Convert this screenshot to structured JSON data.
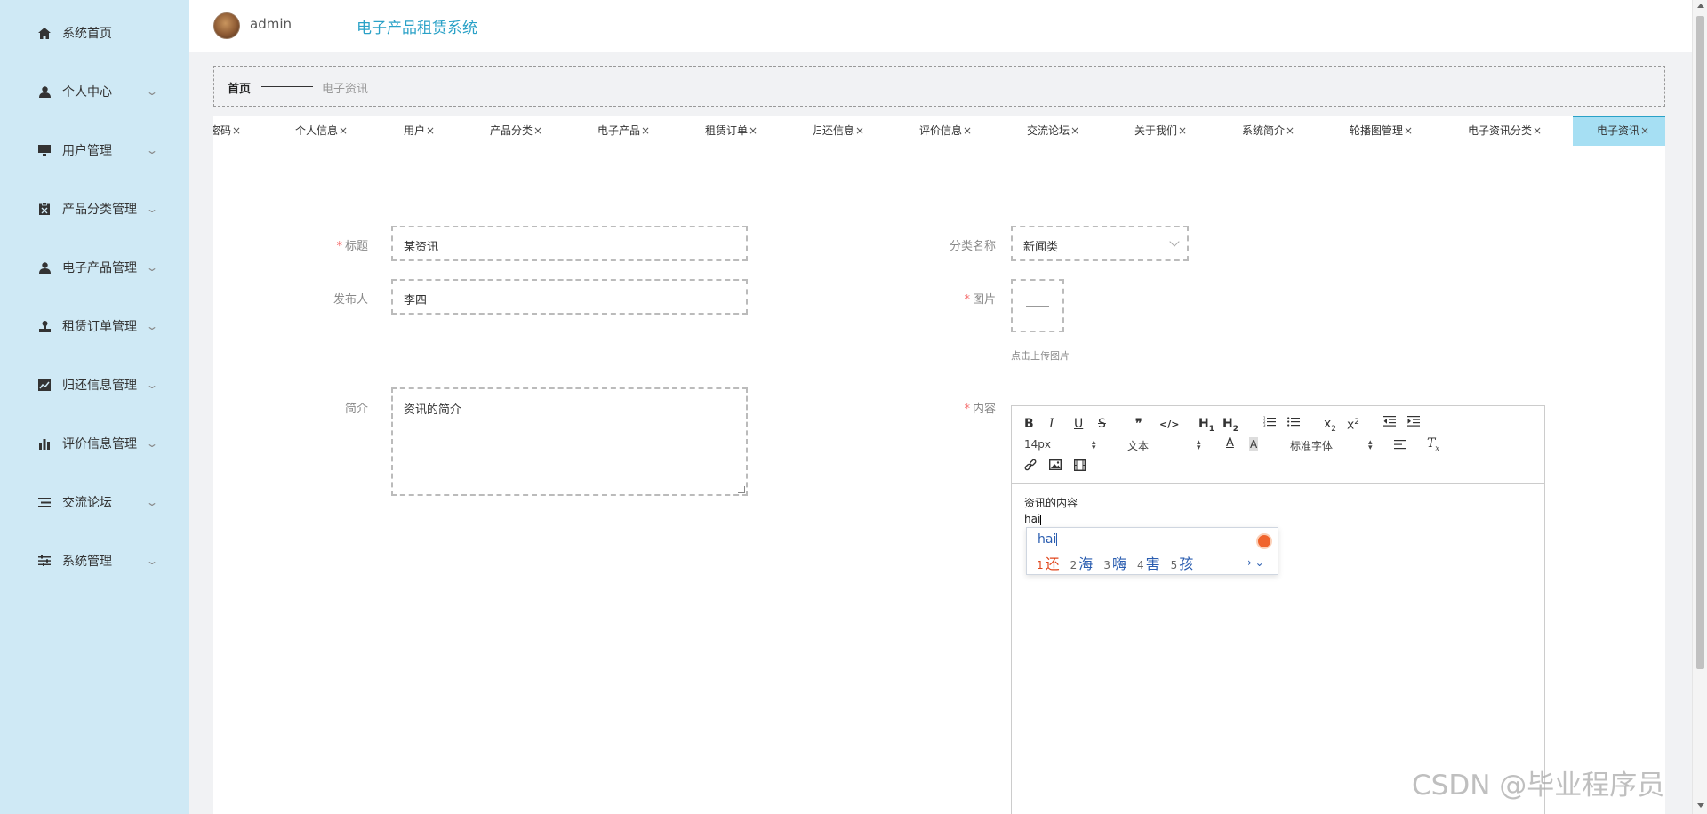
{
  "sidebar": {
    "items": [
      {
        "label": "系统首页",
        "icon": "home-icon",
        "has_submenu": false
      },
      {
        "label": "个人中心",
        "icon": "user-icon",
        "has_submenu": true
      },
      {
        "label": "用户管理",
        "icon": "monitor-icon",
        "has_submenu": true
      },
      {
        "label": "产品分类管理",
        "icon": "clipboard-icon",
        "has_submenu": true
      },
      {
        "label": "电子产品管理",
        "icon": "user-icon",
        "has_submenu": true
      },
      {
        "label": "租赁订单管理",
        "icon": "stamp-icon",
        "has_submenu": true
      },
      {
        "label": "归还信息管理",
        "icon": "chart-icon",
        "has_submenu": true
      },
      {
        "label": "评价信息管理",
        "icon": "bar-chart-icon",
        "has_submenu": true
      },
      {
        "label": "交流论坛",
        "icon": "list-icon",
        "has_submenu": true
      },
      {
        "label": "系统管理",
        "icon": "sliders-icon",
        "has_submenu": true
      }
    ]
  },
  "header": {
    "username": "admin",
    "title": "电子产品租赁系统"
  },
  "breadcrumb": {
    "home": "首页",
    "current": "电子资讯"
  },
  "tabs": [
    {
      "label": "密码",
      "active": false
    },
    {
      "label": "个人信息",
      "active": false
    },
    {
      "label": "用户",
      "active": false
    },
    {
      "label": "产品分类",
      "active": false
    },
    {
      "label": "电子产品",
      "active": false
    },
    {
      "label": "租赁订单",
      "active": false
    },
    {
      "label": "归还信息",
      "active": false
    },
    {
      "label": "评价信息",
      "active": false
    },
    {
      "label": "交流论坛",
      "active": false
    },
    {
      "label": "关于我们",
      "active": false
    },
    {
      "label": "系统简介",
      "active": false
    },
    {
      "label": "轮播图管理",
      "active": false
    },
    {
      "label": "电子资讯分类",
      "active": false
    },
    {
      "label": "电子资讯",
      "active": true
    }
  ],
  "tab_close": "×",
  "form": {
    "title_label": "标题",
    "title_value": "某资讯",
    "category_label": "分类名称",
    "category_value": "新闻类",
    "publisher_label": "发布人",
    "publisher_value": "李四",
    "image_label": "图片",
    "upload_hint": "点击上传图片",
    "summary_label": "简介",
    "summary_value": "资讯的简介",
    "content_label": "内容",
    "required_mark": "*"
  },
  "editor": {
    "font_size": "14px",
    "paragraph": "文本",
    "font_family": "标准字体",
    "content_line1": "资讯的内容",
    "content_line2": "hai"
  },
  "ime": {
    "input": "hai",
    "candidates": [
      {
        "num": "1",
        "text": "还",
        "selected": true
      },
      {
        "num": "2",
        "text": "海",
        "selected": false
      },
      {
        "num": "3",
        "text": "嗨",
        "selected": false
      },
      {
        "num": "4",
        "text": "害",
        "selected": false
      },
      {
        "num": "5",
        "text": "孩",
        "selected": false
      }
    ]
  },
  "watermark": "CSDN @毕业程序员",
  "colors": {
    "sidebar_bg": "#cfe9f5",
    "accent": "#2aa1c7",
    "active_tab_bg": "#a6dff3",
    "required": "#f56c6c"
  }
}
